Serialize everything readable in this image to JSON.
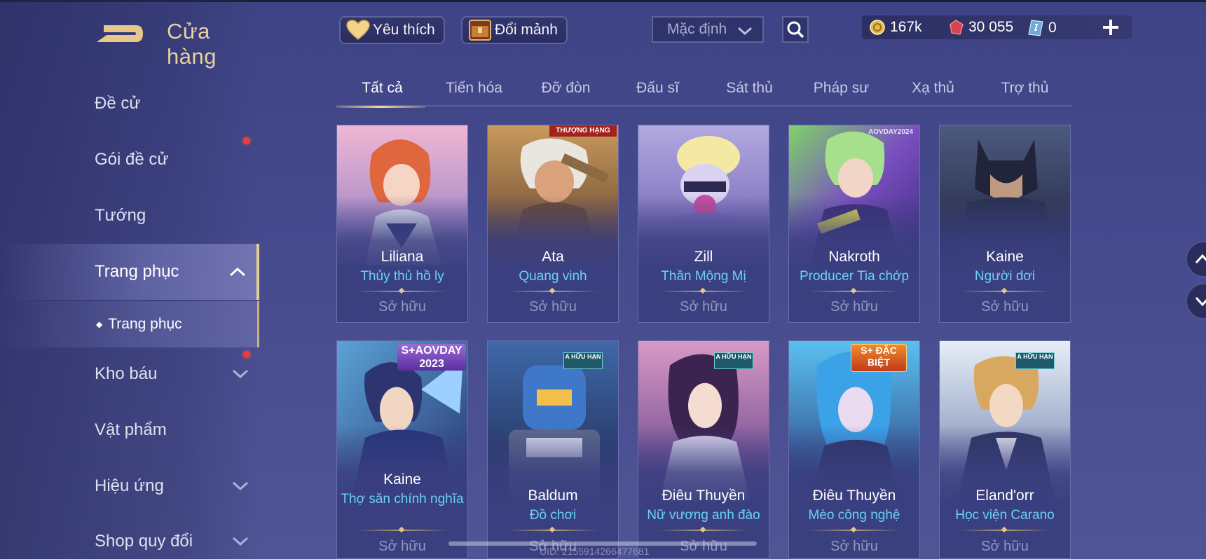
{
  "header": {
    "title": "Cửa hàng",
    "favorites_label": "Yêu thích",
    "exchange_label": "Đổi mảnh",
    "sort_value": "Mặc định"
  },
  "currency": {
    "gold": "167k",
    "vouchers": "30 055",
    "tokens": "0"
  },
  "sidebar": {
    "items": [
      {
        "label": "Đề cử"
      },
      {
        "label": "Gói đề cử"
      },
      {
        "label": "Tướng"
      },
      {
        "label": "Trang phục"
      },
      {
        "label": "Kho báu"
      },
      {
        "label": "Vật phẩm"
      },
      {
        "label": "Hiệu ứng"
      },
      {
        "label": "Shop quy đổi"
      }
    ],
    "sub_item": "Trang phục"
  },
  "tabs": [
    "Tất cả",
    "Tiến hóa",
    "Đỡ đòn",
    "Đấu sĩ",
    "Sát thủ",
    "Pháp sư",
    "Xạ thủ",
    "Trợ thủ"
  ],
  "cards": [
    {
      "hero": "Liliana",
      "skin": "Thủy thủ hồ ly",
      "status": "Sở hữu"
    },
    {
      "hero": "Ata",
      "skin": "Quang vinh",
      "status": "Sở hữu",
      "badge": "THƯỢNG HẠNG"
    },
    {
      "hero": "Zill",
      "skin": "Thần Mộng Mị",
      "status": "Sở hữu"
    },
    {
      "hero": "Nakroth",
      "skin": "Producer Tia chớp",
      "status": "Sở hữu",
      "badge": "AOVDAY2024"
    },
    {
      "hero": "Kaine",
      "skin": "Người dơi",
      "status": "Sở hữu"
    },
    {
      "hero": "Kaine",
      "skin": "Thợ săn chính nghĩa",
      "status": "Sở hữu",
      "badge": "S+AOVDAY 2023"
    },
    {
      "hero": "Baldum",
      "skin": "Đồ chơi",
      "status": "Sở hữu",
      "badge": "A HỮU HẠN"
    },
    {
      "hero": "Điêu Thuyền",
      "skin": "Nữ vương anh đào",
      "status": "Sở hữu",
      "badge": "A HỮU HẠN"
    },
    {
      "hero": "Điêu Thuyền",
      "skin": "Mèo công nghệ",
      "status": "Sở hữu",
      "badge": "S+ ĐẶC BIỆT"
    },
    {
      "hero": "Eland'orr",
      "skin": "Học viện Carano",
      "status": "Sở hữu",
      "badge": "A HỮU HẠN"
    }
  ],
  "footer": {
    "uid": "UID: 2155914266477681"
  },
  "colors": {
    "accent_gold": "#e8d29c",
    "skin_blue": "#69d2f4",
    "notification_red": "#ee3a3a",
    "background": "#454a8e"
  }
}
